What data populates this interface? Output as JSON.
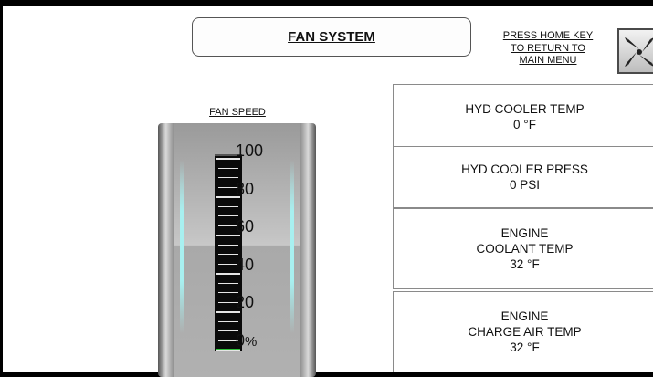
{
  "header": {
    "title": "FAN SYSTEM",
    "home_hint": "PRESS HOME KEY\nTO RETURN TO\nMAIN MENU"
  },
  "gauge": {
    "label": "FAN SPEED",
    "value": 0,
    "scale": [
      "100",
      "80",
      "60",
      "40",
      "20",
      "0"
    ],
    "unit": "%"
  },
  "readings": [
    {
      "title": "HYD COOLER TEMP",
      "value": "0 °F"
    },
    {
      "title": "HYD COOLER PRESS",
      "value": "0 PSI"
    },
    {
      "title": "ENGINE\nCOOLANT TEMP",
      "value": "32 °F"
    },
    {
      "title": "ENGINE\nCHARGE AIR TEMP",
      "value": "32 °F"
    }
  ],
  "colors": {
    "gauge_fill": "#2fbf3a",
    "background": "#ffffff"
  },
  "icons": {
    "home_button": "fan-icon"
  }
}
